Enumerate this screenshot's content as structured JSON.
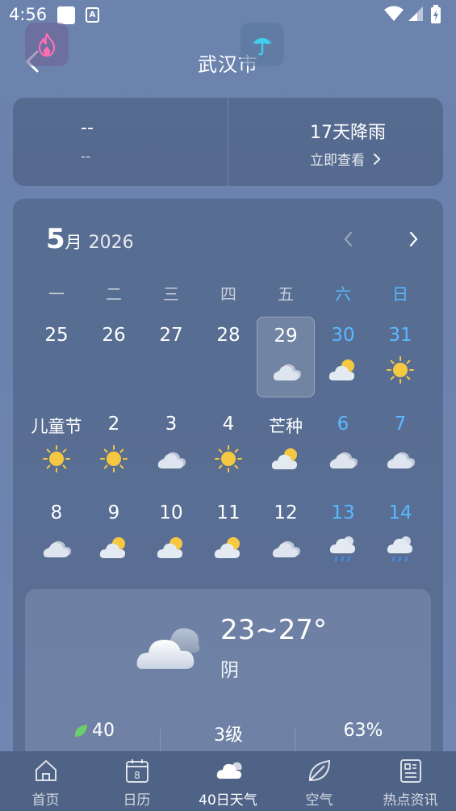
{
  "status_bar": {
    "time": "4:56",
    "a_badge": "A"
  },
  "header": {
    "title": "武汉市"
  },
  "top_card": {
    "fire_value": "--",
    "fire_sub": "--",
    "rain_title": "17天降雨",
    "rain_link": "立即查看"
  },
  "calendar": {
    "month": "5",
    "month_suffix": "月",
    "year": "2026",
    "weekdays": [
      "一",
      "二",
      "三",
      "四",
      "五",
      "六",
      "日"
    ],
    "weeks": [
      [
        {
          "label": "25",
          "icon": "none"
        },
        {
          "label": "26",
          "icon": "none"
        },
        {
          "label": "27",
          "icon": "none"
        },
        {
          "label": "28",
          "icon": "none"
        },
        {
          "label": "29",
          "icon": "cloudy",
          "selected": true
        },
        {
          "label": "30",
          "icon": "partly-cloudy"
        },
        {
          "label": "31",
          "icon": "sunny"
        }
      ],
      [
        {
          "label": "儿童节",
          "icon": "sunny"
        },
        {
          "label": "2",
          "icon": "sunny"
        },
        {
          "label": "3",
          "icon": "cloudy"
        },
        {
          "label": "4",
          "icon": "sunny"
        },
        {
          "label": "芒种",
          "icon": "partly-cloudy"
        },
        {
          "label": "6",
          "icon": "cloudy"
        },
        {
          "label": "7",
          "icon": "cloudy"
        }
      ],
      [
        {
          "label": "8",
          "icon": "cloudy"
        },
        {
          "label": "9",
          "icon": "partly-cloudy"
        },
        {
          "label": "10",
          "icon": "partly-cloudy"
        },
        {
          "label": "11",
          "icon": "partly-cloudy"
        },
        {
          "label": "12",
          "icon": "cloudy"
        },
        {
          "label": "13",
          "icon": "rain"
        },
        {
          "label": "14",
          "icon": "rain"
        }
      ]
    ]
  },
  "detail": {
    "temp_range": "23~27°",
    "condition": "阴",
    "aqi": "40",
    "wind": "3级",
    "humidity": "63%"
  },
  "bottom_nav": {
    "items": [
      {
        "label": "首页",
        "icon": "home-icon"
      },
      {
        "label": "日历",
        "icon": "calendar-icon",
        "badge": "8"
      },
      {
        "label": "40日天气",
        "icon": "cloud-icon",
        "active": true
      },
      {
        "label": "空气",
        "icon": "leaf-icon"
      },
      {
        "label": "热点资讯",
        "icon": "news-icon"
      }
    ]
  },
  "colors": {
    "weekend": "#5ab8ff",
    "sun": "#f5c842",
    "fire": "#ff6fb5",
    "umbrella": "#3fd0f0",
    "leaf": "#6ad06a"
  }
}
